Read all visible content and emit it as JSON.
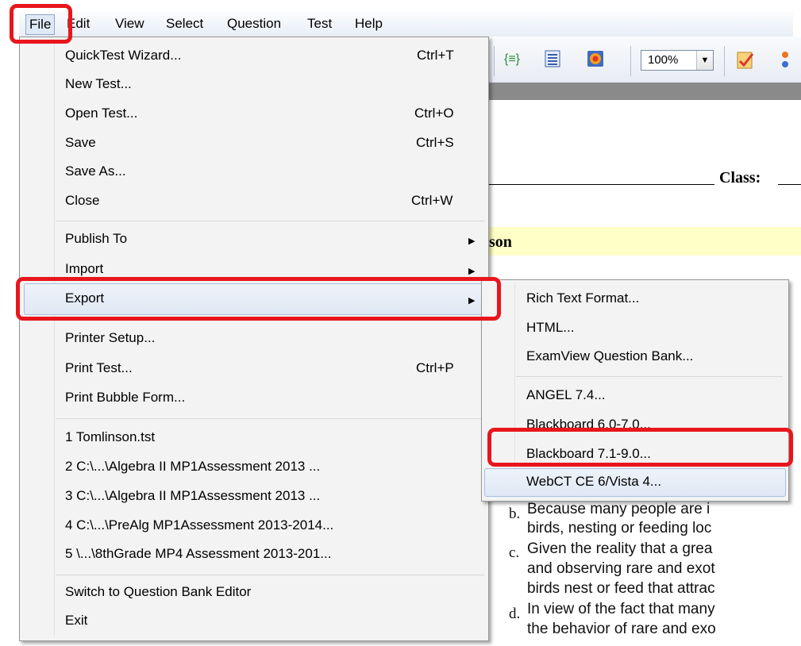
{
  "menubar": {
    "items": [
      "File",
      "Edit",
      "View",
      "Select",
      "Question",
      "Test",
      "Help"
    ]
  },
  "toolbar": {
    "zoom": "100%"
  },
  "file_menu": {
    "quicktest_wizard": {
      "label": "QuickTest Wizard...",
      "shortcut": "Ctrl+T"
    },
    "new_test": {
      "label": "New Test..."
    },
    "open_test": {
      "label": "Open Test...",
      "shortcut": "Ctrl+O"
    },
    "save": {
      "label": "Save",
      "shortcut": "Ctrl+S"
    },
    "save_as": {
      "label": "Save As..."
    },
    "close": {
      "label": "Close",
      "shortcut": "Ctrl+W"
    },
    "publish_to": {
      "label": "Publish To"
    },
    "import": {
      "label": "Import"
    },
    "export": {
      "label": "Export"
    },
    "printer_setup": {
      "label": "Printer Setup..."
    },
    "print_test": {
      "label": "Print Test...",
      "shortcut": "Ctrl+P"
    },
    "print_bubble": {
      "label": "Print Bubble Form..."
    },
    "recent": [
      "1 Tomlinson.tst",
      "2 C:\\...\\Algebra II MP1Assessment 2013 ...",
      "3 C:\\...\\Algebra II MP1Assessment 2013 ...",
      "4 C:\\...\\PreAlg MP1Assessment 2013-2014...",
      "5 \\...\\8thGrade MP4 Assessment 2013-201..."
    ],
    "switch_editor": {
      "label": "Switch to Question Bank Editor"
    },
    "exit": {
      "label": "Exit"
    }
  },
  "export_menu": {
    "items": [
      "Rich Text Format...",
      "HTML...",
      "ExamView Question Bank...",
      "ANGEL 7.4...",
      "Blackboard 6.0-7.0...",
      "Blackboard 7.1-9.0...",
      "WebCT CE 6/Vista 4..."
    ]
  },
  "document": {
    "class_label": "Class:",
    "lesson_fragment": "son",
    "answers": [
      {
        "letter": "b.",
        "lines": [
          "Because many people are i",
          "birds, nesting or feeding loc"
        ]
      },
      {
        "letter": "c.",
        "lines": [
          "Given the reality that a grea",
          "and observing rare and exot",
          "birds nest or feed that attrac"
        ]
      },
      {
        "letter": "d.",
        "lines": [
          "In view of the fact that many",
          "the behavior of rare and exo"
        ]
      }
    ]
  },
  "colors": {
    "annotation_red": "#e8161c",
    "highlight_blue": "#dfe8f5",
    "lesson_band": "#ffffc8"
  }
}
